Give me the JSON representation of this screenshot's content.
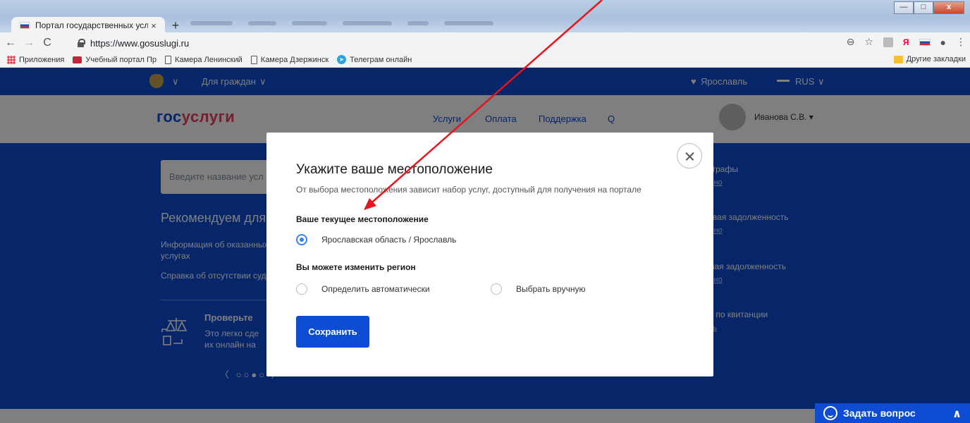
{
  "browser": {
    "tab_title": "Портал государственных услуг",
    "tab_close": "×",
    "new_tab": "+",
    "url": "https://www.gosuslugi.ru",
    "win_minimize": "—",
    "win_maximize": "□",
    "win_close": "x",
    "nav": {
      "back": "←",
      "forward": "→",
      "reload": "C"
    },
    "icons": {
      "zoom": "⊖",
      "star": "☆",
      "profile": "●",
      "menu": "⋮",
      "yandex": "Я"
    },
    "bookmarks": [
      {
        "label": "Приложения"
      },
      {
        "label": "Учебный портал Пр"
      },
      {
        "label": "Камера Ленинский"
      },
      {
        "label": "Камера Дзержинск"
      },
      {
        "label": "Телеграм онлайн"
      }
    ],
    "other_bookmarks": "Другие закладки"
  },
  "site": {
    "top_nav": {
      "emblem_chevron": "∨",
      "citizens": "Для граждан",
      "citizens_chevron": "∨",
      "city": "Ярославль",
      "lang": "RUS",
      "lang_chevron": "∨"
    },
    "logo_part1": "гос",
    "logo_part2": "услуги",
    "menu": [
      "Услуги",
      "Оплата",
      "Поддержка"
    ],
    "search_glyph": "Q",
    "user_name": "Иванова С.В. ▾",
    "search_placeholder": "Введите название усл",
    "recommend_title": "Рекомендуем для ж",
    "recommend_items": [
      "Информация об оказанных",
      "услугах",
      "Справка об отсутствии суди"
    ],
    "promo_title": "Проверьте ",
    "promo_text": [
      "Это легко сде",
      "их онлайн на "
    ],
    "carousel": "〈 ○○●○ 〉",
    "right_items": [
      {
        "title": "штрафы",
        "link": "дено"
      },
      {
        "title": "говая задолженность",
        "link": "дено"
      },
      {
        "title": "бная задолженность",
        "link": "дено"
      },
      {
        "title": "та по квитанции",
        "link": "ить"
      }
    ],
    "ask_label": "Задать вопрос",
    "ask_chevron": "∧"
  },
  "modal": {
    "title": "Укажите ваше местоположение",
    "subtitle": "От выбора местоположения зависит набор услуг, доступный для получения на портале",
    "current_label": "Ваше текущее местоположение",
    "current_value": "Ярославская область / Ярославль",
    "change_label": "Вы можете изменить регион",
    "option_auto": "Определить автоматически",
    "option_manual": "Выбрать вручную",
    "save_button": "Сохранить"
  },
  "colors": {
    "brand_blue": "#0d4cd3",
    "brand_red": "#ee3f58",
    "radio_accent": "#3b80e8",
    "annotation_arrow": "#e8141b"
  }
}
